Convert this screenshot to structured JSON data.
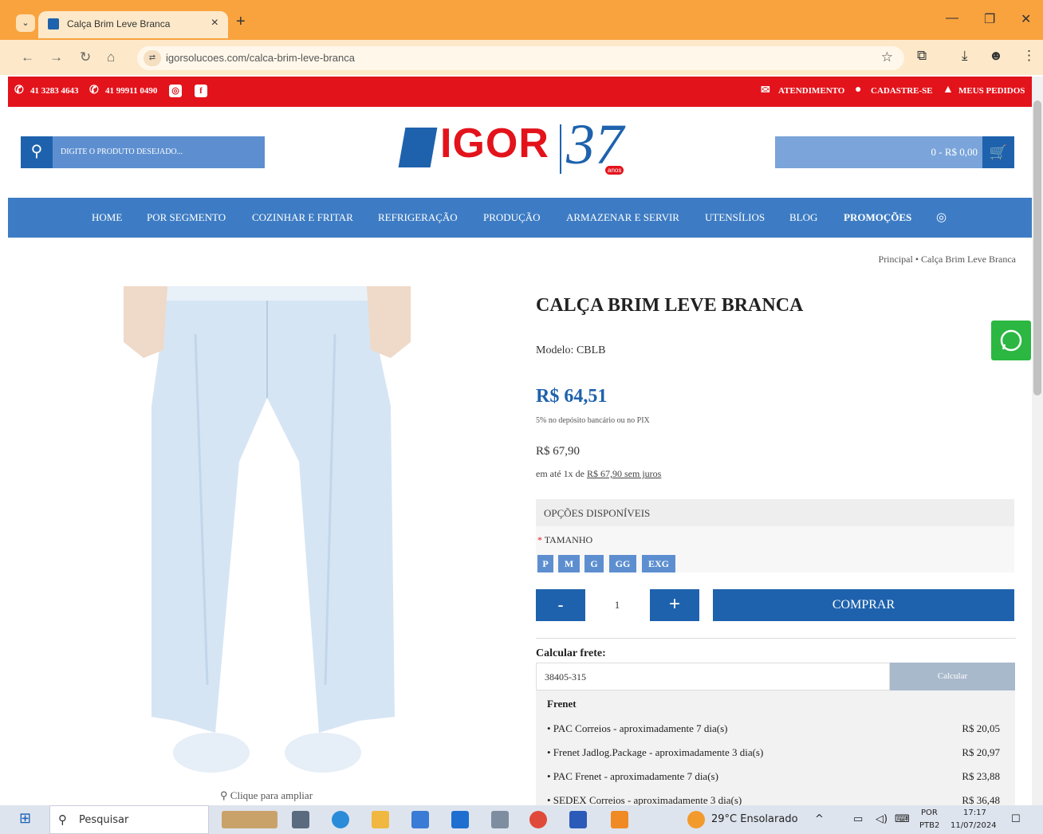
{
  "browser": {
    "tab_title": "Calça Brim Leve Branca",
    "url": "igorsolucoes.com/calca-brim-leve-branca"
  },
  "topbar": {
    "phone": "41 3283 4643",
    "whatsapp": "41 99911 0490",
    "atendimento": "ATENDIMENTO",
    "cadastre": "CADASTRE-SE",
    "pedidos": "MEUS PEDIDOS"
  },
  "header": {
    "search_placeholder": "DIGITE O PRODUTO DESEJADO...",
    "logo_text": "IGOR",
    "logo_years": "37",
    "logo_badge": "anos",
    "cart_total": "0 - R$ 0,00"
  },
  "menu": [
    {
      "label": "HOME"
    },
    {
      "label": "POR SEGMENTO"
    },
    {
      "label": "COZINHAR E FRITAR"
    },
    {
      "label": "REFRIGERAÇÃO"
    },
    {
      "label": "PRODUÇÃO"
    },
    {
      "label": "ARMAZENAR E SERVIR"
    },
    {
      "label": "UTENSÍLIOS"
    },
    {
      "label": "BLOG"
    },
    {
      "label": "PROMOÇÕES"
    }
  ],
  "breadcrumb": "Principal  •  Calça Brim Leve Branca",
  "product": {
    "title": "CALÇA BRIM LEVE BRANCA",
    "model": "Modelo: CBLB",
    "price": "R$ 64,51",
    "pix_note": "5% no depósito bancário ou no PIX",
    "old_price": "R$ 67,90",
    "install_prefix": "em até 1x de",
    "install_link": "R$ 67,90 sem juros",
    "zoom_text": "Clique para ampliar"
  },
  "options": {
    "header": "OPÇÕES DISPONÍVEIS",
    "label": "TAMANHO",
    "sizes": [
      "P",
      "M",
      "G",
      "GG",
      "EXG"
    ]
  },
  "cart_controls": {
    "minus": "-",
    "qty": "1",
    "plus": "+",
    "buy": "COMPRAR"
  },
  "frete": {
    "title": "Calcular frete:",
    "cep": "38405-315",
    "calc_button": "Calcular",
    "provider": "Frenet",
    "rows": [
      {
        "name": "• PAC Correios - aproximadamente 7 dia(s)",
        "price": "R$ 20,05"
      },
      {
        "name": "• Frenet Jadlog.Package - aproximadamente 3 dia(s)",
        "price": "R$ 20,97"
      },
      {
        "name": "• PAC Frenet - aproximadamente 7 dia(s)",
        "price": "R$ 23,88"
      },
      {
        "name": "• SEDEX Correios - aproximadamente 3 dia(s)",
        "price": "R$ 36,48"
      }
    ]
  },
  "taskbar": {
    "search": "Pesquisar",
    "weather": "29°C  Ensolarado",
    "lang1": "POR",
    "lang2": "PTB2",
    "time": "17:17",
    "date": "11/07/2024"
  },
  "colors": {
    "brand_red": "#e3131b",
    "brand_blue": "#1e62ad",
    "menu_blue": "#3d7cc4",
    "browser_orange": "#f9a33f"
  }
}
